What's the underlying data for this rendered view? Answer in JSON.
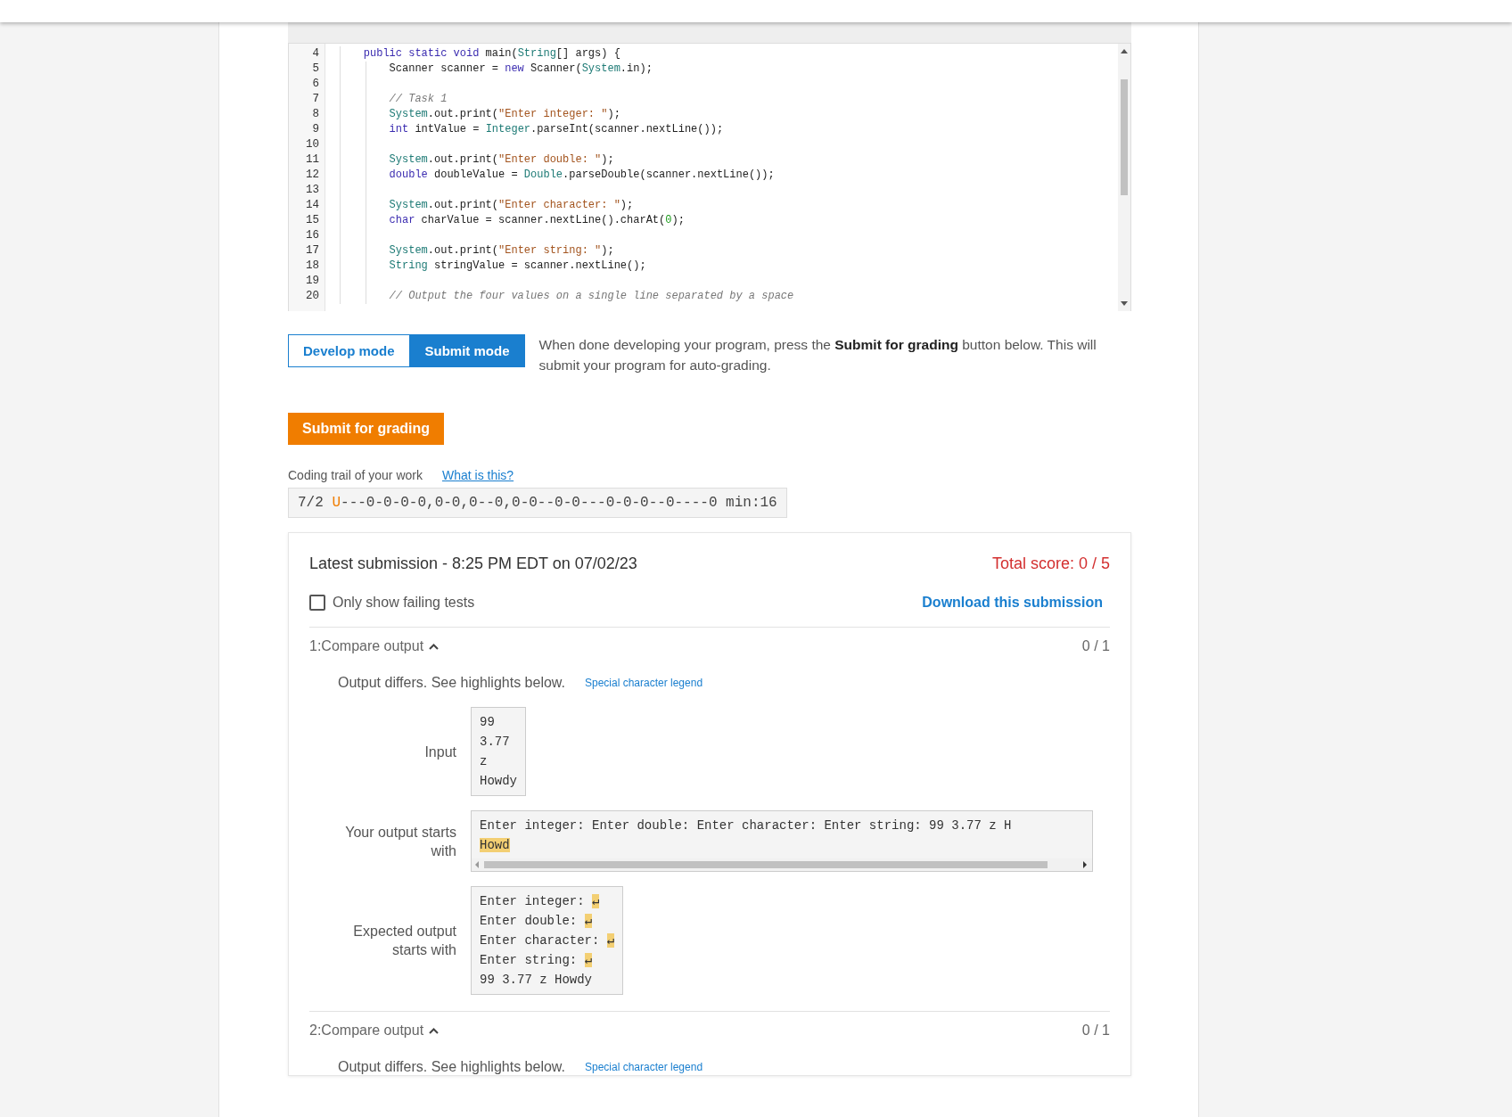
{
  "editor": {
    "lines": [
      {
        "number": "4",
        "kind": "method",
        "tokens": [
          {
            "kind": "keyword",
            "text": "public static void"
          },
          {
            "kind": "plain",
            "text": " main("
          },
          {
            "kind": "type",
            "text": "String"
          },
          {
            "kind": "plain",
            "text": "[] args) {"
          }
        ]
      },
      {
        "number": "5",
        "kind": "body",
        "tokens": [
          {
            "kind": "plain",
            "text": "Scanner scanner = "
          },
          {
            "kind": "keyword",
            "text": "new"
          },
          {
            "kind": "plain",
            "text": " Scanner("
          },
          {
            "kind": "type",
            "text": "System"
          },
          {
            "kind": "plain",
            "text": ".in);"
          }
        ]
      },
      {
        "number": "6",
        "kind": "body"
      },
      {
        "number": "7",
        "kind": "body",
        "tokens": [
          {
            "kind": "comment",
            "text": "// Task 1"
          }
        ]
      },
      {
        "number": "8",
        "kind": "body",
        "tokens": [
          {
            "kind": "type",
            "text": "System"
          },
          {
            "kind": "plain",
            "text": ".out.print("
          },
          {
            "kind": "string",
            "text": "\"Enter integer: \""
          },
          {
            "kind": "plain",
            "text": ");"
          }
        ]
      },
      {
        "number": "9",
        "kind": "body",
        "tokens": [
          {
            "kind": "keyword",
            "text": "int"
          },
          {
            "kind": "plain",
            "text": " intValue = "
          },
          {
            "kind": "type",
            "text": "Integer"
          },
          {
            "kind": "plain",
            "text": ".parseInt(scanner.nextLine());"
          }
        ]
      },
      {
        "number": "10",
        "kind": "body"
      },
      {
        "number": "11",
        "kind": "body",
        "tokens": [
          {
            "kind": "type",
            "text": "System"
          },
          {
            "kind": "plain",
            "text": ".out.print("
          },
          {
            "kind": "string",
            "text": "\"Enter double: \""
          },
          {
            "kind": "plain",
            "text": ");"
          }
        ]
      },
      {
        "number": "12",
        "kind": "body",
        "tokens": [
          {
            "kind": "keyword",
            "text": "double"
          },
          {
            "kind": "plain",
            "text": " doubleValue = "
          },
          {
            "kind": "type",
            "text": "Double"
          },
          {
            "kind": "plain",
            "text": ".parseDouble(scanner.nextLine());"
          }
        ]
      },
      {
        "number": "13",
        "kind": "body"
      },
      {
        "number": "14",
        "kind": "body",
        "tokens": [
          {
            "kind": "type",
            "text": "System"
          },
          {
            "kind": "plain",
            "text": ".out.print("
          },
          {
            "kind": "string",
            "text": "\"Enter character: \""
          },
          {
            "kind": "plain",
            "text": ");"
          }
        ]
      },
      {
        "number": "15",
        "kind": "body",
        "tokens": [
          {
            "kind": "keyword",
            "text": "char"
          },
          {
            "kind": "plain",
            "text": " charValue = scanner.nextLine().charAt("
          },
          {
            "kind": "number",
            "text": "0"
          },
          {
            "kind": "plain",
            "text": ");"
          }
        ]
      },
      {
        "number": "16",
        "kind": "body"
      },
      {
        "number": "17",
        "kind": "body",
        "tokens": [
          {
            "kind": "type",
            "text": "System"
          },
          {
            "kind": "plain",
            "text": ".out.print("
          },
          {
            "kind": "string",
            "text": "\"Enter string: \""
          },
          {
            "kind": "plain",
            "text": ");"
          }
        ]
      },
      {
        "number": "18",
        "kind": "body",
        "tokens": [
          {
            "kind": "type",
            "text": "String"
          },
          {
            "kind": "plain",
            "text": " stringValue = scanner.nextLine();"
          }
        ]
      },
      {
        "number": "19",
        "kind": "body"
      },
      {
        "number": "20",
        "kind": "body",
        "tokens": [
          {
            "kind": "comment",
            "text": "// Output the four values on a single line separated by a space"
          }
        ]
      }
    ]
  },
  "modes": [
    {
      "label": "Develop mode",
      "selected": false
    },
    {
      "label": "Submit mode",
      "selected": true
    }
  ],
  "mode_description": "When done developing your program, press the **Submit for grading** button below. This will submit your program for auto-grading.",
  "submit_button": "Submit for grading",
  "coding_trail": {
    "label": "Coding trail of your work",
    "link": "What is this?",
    "date": "7/2",
    "marker": "U",
    "trail": "---0-0-0-0,0-0,0--0,0-0--0-0---0-0-0--0----0",
    "time": "min:16"
  },
  "submission": {
    "title": "Latest submission - 8:25 PM EDT on 07/02/23",
    "total_score": "Total score: 0 / 5",
    "filter": {
      "label": "Only show failing tests",
      "checked": false
    },
    "download_link": "Download this submission",
    "tests": [
      {
        "title": "1:Compare output",
        "expanded": true,
        "score": "0 / 1",
        "message": "Output differs. See highlights below.",
        "legend_link": "Special character legend",
        "rows": [
          {
            "kind": "plain",
            "label": "Input",
            "lines": [
              {
                "text": "99"
              },
              {
                "text": "3.77"
              },
              {
                "text": "z"
              },
              {
                "text": "Howdy"
              }
            ]
          },
          {
            "kind": "scroll",
            "label": "Your output starts with",
            "lines": [
              {
                "text": "Enter integer: Enter double: Enter character: Enter string: 99 3.77 z H"
              },
              {
                "highlight": "Howd"
              }
            ]
          },
          {
            "kind": "plain",
            "label": "Expected output starts with",
            "lines": [
              {
                "text": "Enter integer: ",
                "highlight": "↵"
              },
              {
                "text": "Enter double: ",
                "highlight": "↵"
              },
              {
                "text": "Enter character: ",
                "highlight": "↵"
              },
              {
                "text": "Enter string: ",
                "highlight": "↵"
              },
              {
                "text": "99 3.77 z Howdy"
              }
            ]
          }
        ]
      },
      {
        "title": "2:Compare output",
        "expanded": true,
        "score": "0 / 1",
        "message": "Output differs. See highlights below.",
        "legend_link": "Special character legend"
      }
    ]
  }
}
